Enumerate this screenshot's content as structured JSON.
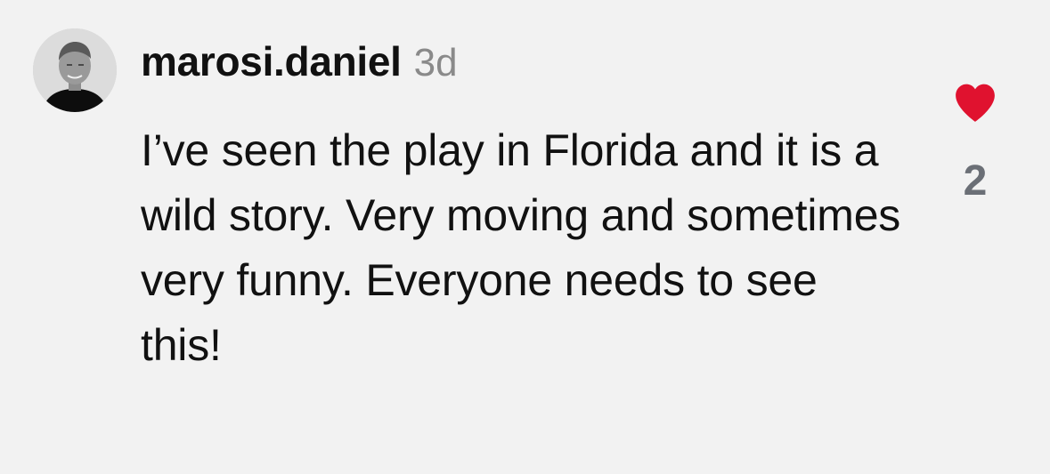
{
  "comment": {
    "username": "marosi.daniel",
    "timestamp": "3d",
    "text": "I’ve seen the play in Florida and it is a wild story. Very moving and sometimes very funny. Everyone needs to see this!",
    "avatar_icon": "user-avatar-icon",
    "like": {
      "icon": "heart-icon",
      "liked": true,
      "count": "2",
      "color": "#e0122f"
    }
  },
  "colors": {
    "background": "#f2f2f2",
    "text": "#111111",
    "muted": "#8a8a8a",
    "count": "#6b6f76"
  }
}
